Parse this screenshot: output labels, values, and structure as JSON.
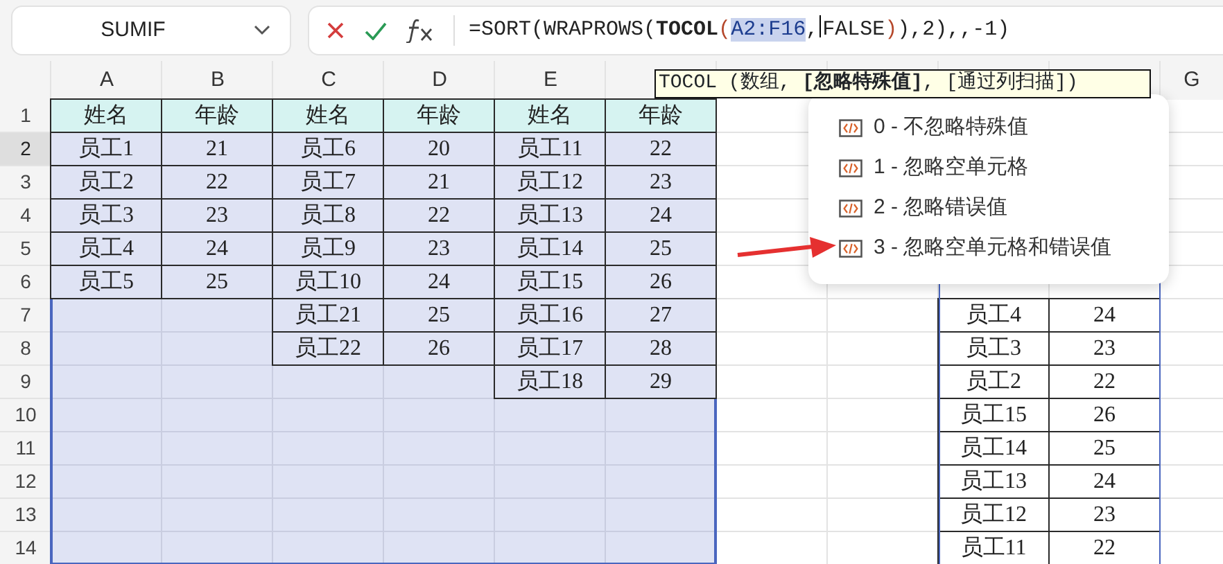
{
  "name_box": {
    "value": "SUMIF"
  },
  "formula_bar": {
    "segments": [
      {
        "text": "=SORT(WRAPROWS(",
        "kind": "plain"
      },
      {
        "text": "TOCOL",
        "kind": "function"
      },
      {
        "text": "(",
        "kind": "paren"
      },
      {
        "text": "A2:F16",
        "kind": "ref"
      },
      {
        "text": ",",
        "kind": "plain"
      },
      {
        "kind": "cursor"
      },
      {
        "text": "FALSE",
        "kind": "plain"
      },
      {
        "text": ")",
        "kind": "paren"
      },
      {
        "text": "),2),,-1)",
        "kind": "plain"
      }
    ]
  },
  "column_headers": [
    "A",
    "B",
    "C",
    "D",
    "E"
  ],
  "far_column_header": "G",
  "row_headers": [
    {
      "label": "1",
      "selected": false
    },
    {
      "label": "2",
      "selected": true
    },
    {
      "label": "3",
      "selected": false
    },
    {
      "label": "4",
      "selected": false
    },
    {
      "label": "5",
      "selected": false
    },
    {
      "label": "6",
      "selected": false
    },
    {
      "label": "7",
      "selected": false
    },
    {
      "label": "8",
      "selected": false
    },
    {
      "label": "9",
      "selected": false
    },
    {
      "label": "10",
      "selected": false
    },
    {
      "label": "11",
      "selected": false
    },
    {
      "label": "12",
      "selected": false
    },
    {
      "label": "13",
      "selected": false
    },
    {
      "label": "14",
      "selected": false
    }
  ],
  "source_table": {
    "highlighted": true,
    "header": [
      "姓名",
      "年龄",
      "姓名",
      "年龄",
      "姓名",
      "年龄"
    ],
    "rows": [
      [
        "员工1",
        "21",
        "员工6",
        "20",
        "员工11",
        "22"
      ],
      [
        "员工2",
        "22",
        "员工7",
        "21",
        "员工12",
        "23"
      ],
      [
        "员工3",
        "23",
        "员工8",
        "22",
        "员工13",
        "24"
      ],
      [
        "员工4",
        "24",
        "员工9",
        "23",
        "员工14",
        "25"
      ],
      [
        "员工5",
        "25",
        "员工10",
        "24",
        "员工15",
        "26"
      ],
      [
        null,
        null,
        "员工21",
        "25",
        "员工16",
        "27"
      ],
      [
        null,
        null,
        "员工22",
        "26",
        "员工17",
        "28"
      ],
      [
        null,
        null,
        null,
        null,
        "员工18",
        "29"
      ]
    ]
  },
  "result_table": {
    "rows": [
      [
        "员工4",
        "24"
      ],
      [
        "员工3",
        "23"
      ],
      [
        "员工2",
        "22"
      ],
      [
        "员工15",
        "26"
      ],
      [
        "员工14",
        "25"
      ],
      [
        "员工13",
        "24"
      ],
      [
        "员工12",
        "23"
      ],
      [
        "员工11",
        "22"
      ]
    ]
  },
  "function_tooltip": {
    "text": "TOCOL (数组, **[忽略特殊值]**, [通过列扫描])"
  },
  "autocomplete": {
    "items": [
      {
        "label": "0 - 不忽略特殊值"
      },
      {
        "label": "1 - 忽略空单元格"
      },
      {
        "label": "2 - 忽略错误值"
      },
      {
        "label": "3 - 忽略空单元格和错误值"
      }
    ]
  }
}
